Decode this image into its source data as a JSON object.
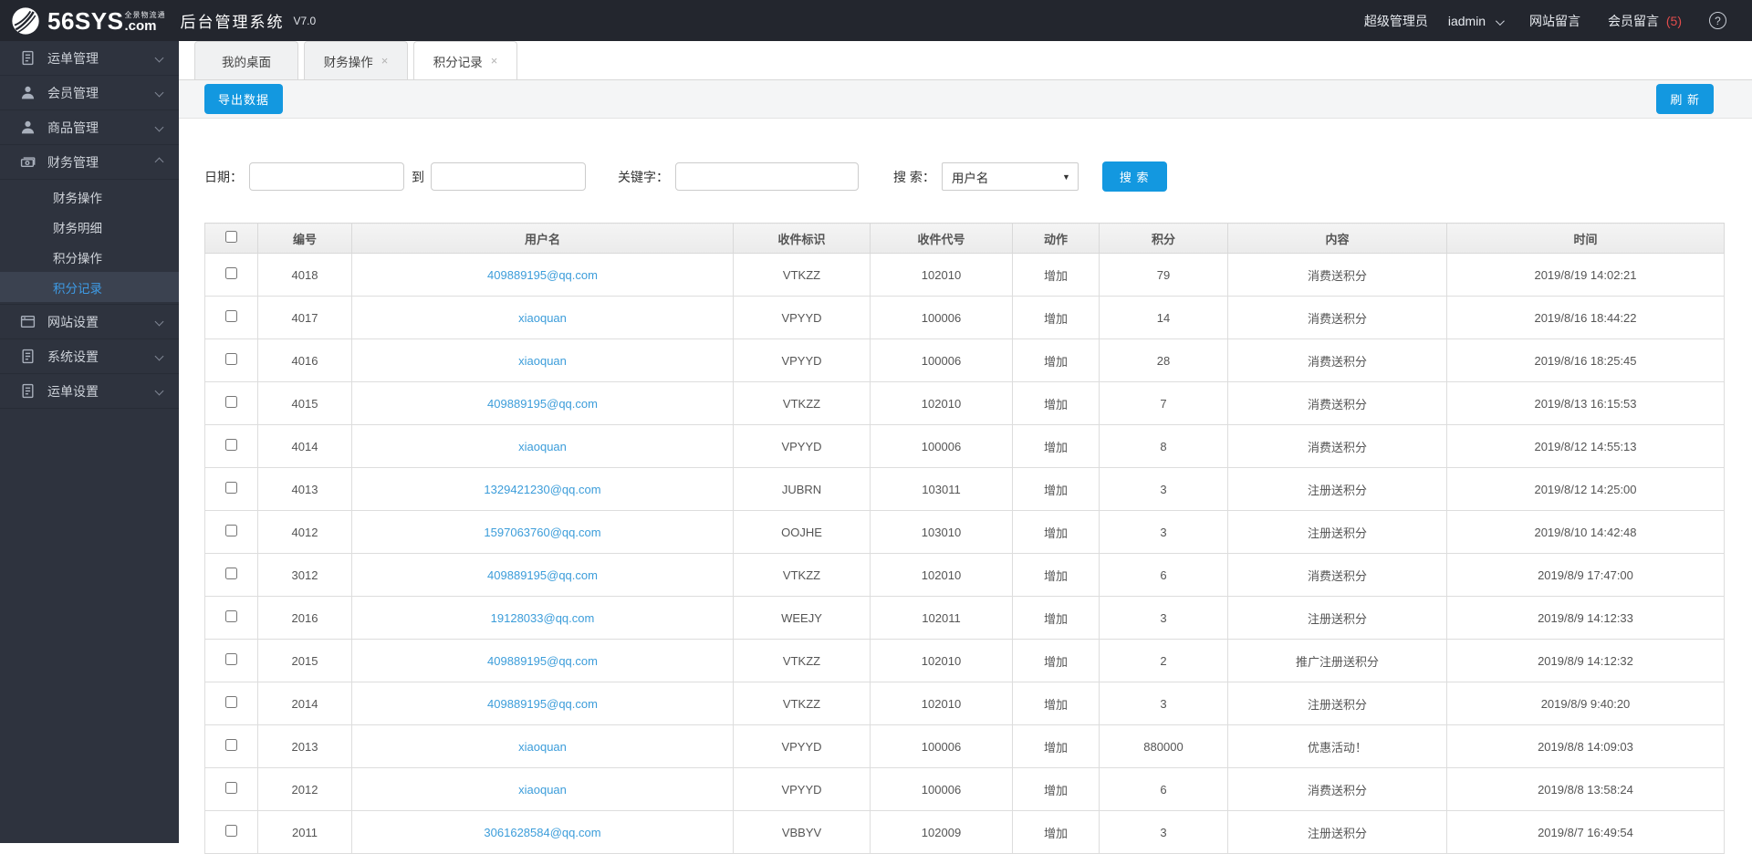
{
  "header": {
    "brand_main": "56SYS",
    "brand_tagline": "全景物流通",
    "brand_tld": ".com",
    "app_title": "后台管理系统",
    "version": "V7.0",
    "role": "超级管理员",
    "username": "iadmin",
    "site_messages_label": "网站留言",
    "member_messages_label": "会员留言",
    "member_message_count": "(5)",
    "help_icon": "help-icon",
    "help_glyph": "?"
  },
  "colors": {
    "accent": "#1398e0",
    "link": "#3c9dda",
    "badge_red": "#e24c4c",
    "header_bg": "#23262e",
    "sidebar_bg": "#2e333e"
  },
  "sidebar": {
    "items": [
      {
        "label": "运单管理",
        "icon": "waybill-doc-icon"
      },
      {
        "label": "会员管理",
        "icon": "member-person-icon"
      },
      {
        "label": "商品管理",
        "icon": "product-person-icon"
      },
      {
        "label": "财务管理",
        "icon": "finance-money-icon",
        "expanded": true,
        "children": [
          {
            "label": "财务操作"
          },
          {
            "label": "财务明细"
          },
          {
            "label": "积分操作"
          },
          {
            "label": "积分记录",
            "selected": true
          }
        ]
      },
      {
        "label": "网站设置",
        "icon": "website-browser-icon"
      },
      {
        "label": "系统设置",
        "icon": "system-doc-icon"
      },
      {
        "label": "运单设置",
        "icon": "waybill-settings-doc-icon"
      }
    ]
  },
  "tabs": [
    {
      "label": "我的桌面",
      "closable": false,
      "active": false
    },
    {
      "label": "财务操作",
      "closable": true,
      "active": false
    },
    {
      "label": "积分记录",
      "closable": true,
      "active": true
    }
  ],
  "close_glyph": "×",
  "toolbar": {
    "export_label": "导出数据",
    "refresh_label": "刷 新"
  },
  "filter": {
    "date_label": "日期：",
    "to_label": "到",
    "keyword_label": "关键字：",
    "search_by_label": "搜 索：",
    "search_by_value": "用户名",
    "search_button_label": "搜 索"
  },
  "table": {
    "headers": [
      "编号",
      "用户名",
      "收件标识",
      "收件代号",
      "动作",
      "积分",
      "内容",
      "时间"
    ],
    "rows": [
      {
        "id": "4018",
        "username": "409889195@qq.com",
        "recipient_mark": "VTKZZ",
        "recipient_code": "102010",
        "action": "增加",
        "points": "79",
        "content": "消费送积分",
        "time": "2019/8/19 14:02:21"
      },
      {
        "id": "4017",
        "username": "xiaoquan",
        "recipient_mark": "VPYYD",
        "recipient_code": "100006",
        "action": "增加",
        "points": "14",
        "content": "消费送积分",
        "time": "2019/8/16 18:44:22"
      },
      {
        "id": "4016",
        "username": "xiaoquan",
        "recipient_mark": "VPYYD",
        "recipient_code": "100006",
        "action": "增加",
        "points": "28",
        "content": "消费送积分",
        "time": "2019/8/16 18:25:45"
      },
      {
        "id": "4015",
        "username": "409889195@qq.com",
        "recipient_mark": "VTKZZ",
        "recipient_code": "102010",
        "action": "增加",
        "points": "7",
        "content": "消费送积分",
        "time": "2019/8/13 16:15:53"
      },
      {
        "id": "4014",
        "username": "xiaoquan",
        "recipient_mark": "VPYYD",
        "recipient_code": "100006",
        "action": "增加",
        "points": "8",
        "content": "消费送积分",
        "time": "2019/8/12 14:55:13"
      },
      {
        "id": "4013",
        "username": "1329421230@qq.com",
        "recipient_mark": "JUBRN",
        "recipient_code": "103011",
        "action": "增加",
        "points": "3",
        "content": "注册送积分",
        "time": "2019/8/12 14:25:00"
      },
      {
        "id": "4012",
        "username": "1597063760@qq.com",
        "recipient_mark": "OOJHE",
        "recipient_code": "103010",
        "action": "增加",
        "points": "3",
        "content": "注册送积分",
        "time": "2019/8/10 14:42:48"
      },
      {
        "id": "3012",
        "username": "409889195@qq.com",
        "recipient_mark": "VTKZZ",
        "recipient_code": "102010",
        "action": "增加",
        "points": "6",
        "content": "消费送积分",
        "time": "2019/8/9 17:47:00"
      },
      {
        "id": "2016",
        "username": "19128033@qq.com",
        "recipient_mark": "WEEJY",
        "recipient_code": "102011",
        "action": "增加",
        "points": "3",
        "content": "注册送积分",
        "time": "2019/8/9 14:12:33"
      },
      {
        "id": "2015",
        "username": "409889195@qq.com",
        "recipient_mark": "VTKZZ",
        "recipient_code": "102010",
        "action": "增加",
        "points": "2",
        "content": "推广注册送积分",
        "time": "2019/8/9 14:12:32"
      },
      {
        "id": "2014",
        "username": "409889195@qq.com",
        "recipient_mark": "VTKZZ",
        "recipient_code": "102010",
        "action": "增加",
        "points": "3",
        "content": "注册送积分",
        "time": "2019/8/9 9:40:20"
      },
      {
        "id": "2013",
        "username": "xiaoquan",
        "recipient_mark": "VPYYD",
        "recipient_code": "100006",
        "action": "增加",
        "points": "880000",
        "content": "优惠活动！",
        "time": "2019/8/8 14:09:03"
      },
      {
        "id": "2012",
        "username": "xiaoquan",
        "recipient_mark": "VPYYD",
        "recipient_code": "100006",
        "action": "增加",
        "points": "6",
        "content": "消费送积分",
        "time": "2019/8/8 13:58:24"
      },
      {
        "id": "2011",
        "username": "3061628584@qq.com",
        "recipient_mark": "VBBYV",
        "recipient_code": "102009",
        "action": "增加",
        "points": "3",
        "content": "注册送积分",
        "time": "2019/8/7 16:49:54"
      }
    ]
  }
}
